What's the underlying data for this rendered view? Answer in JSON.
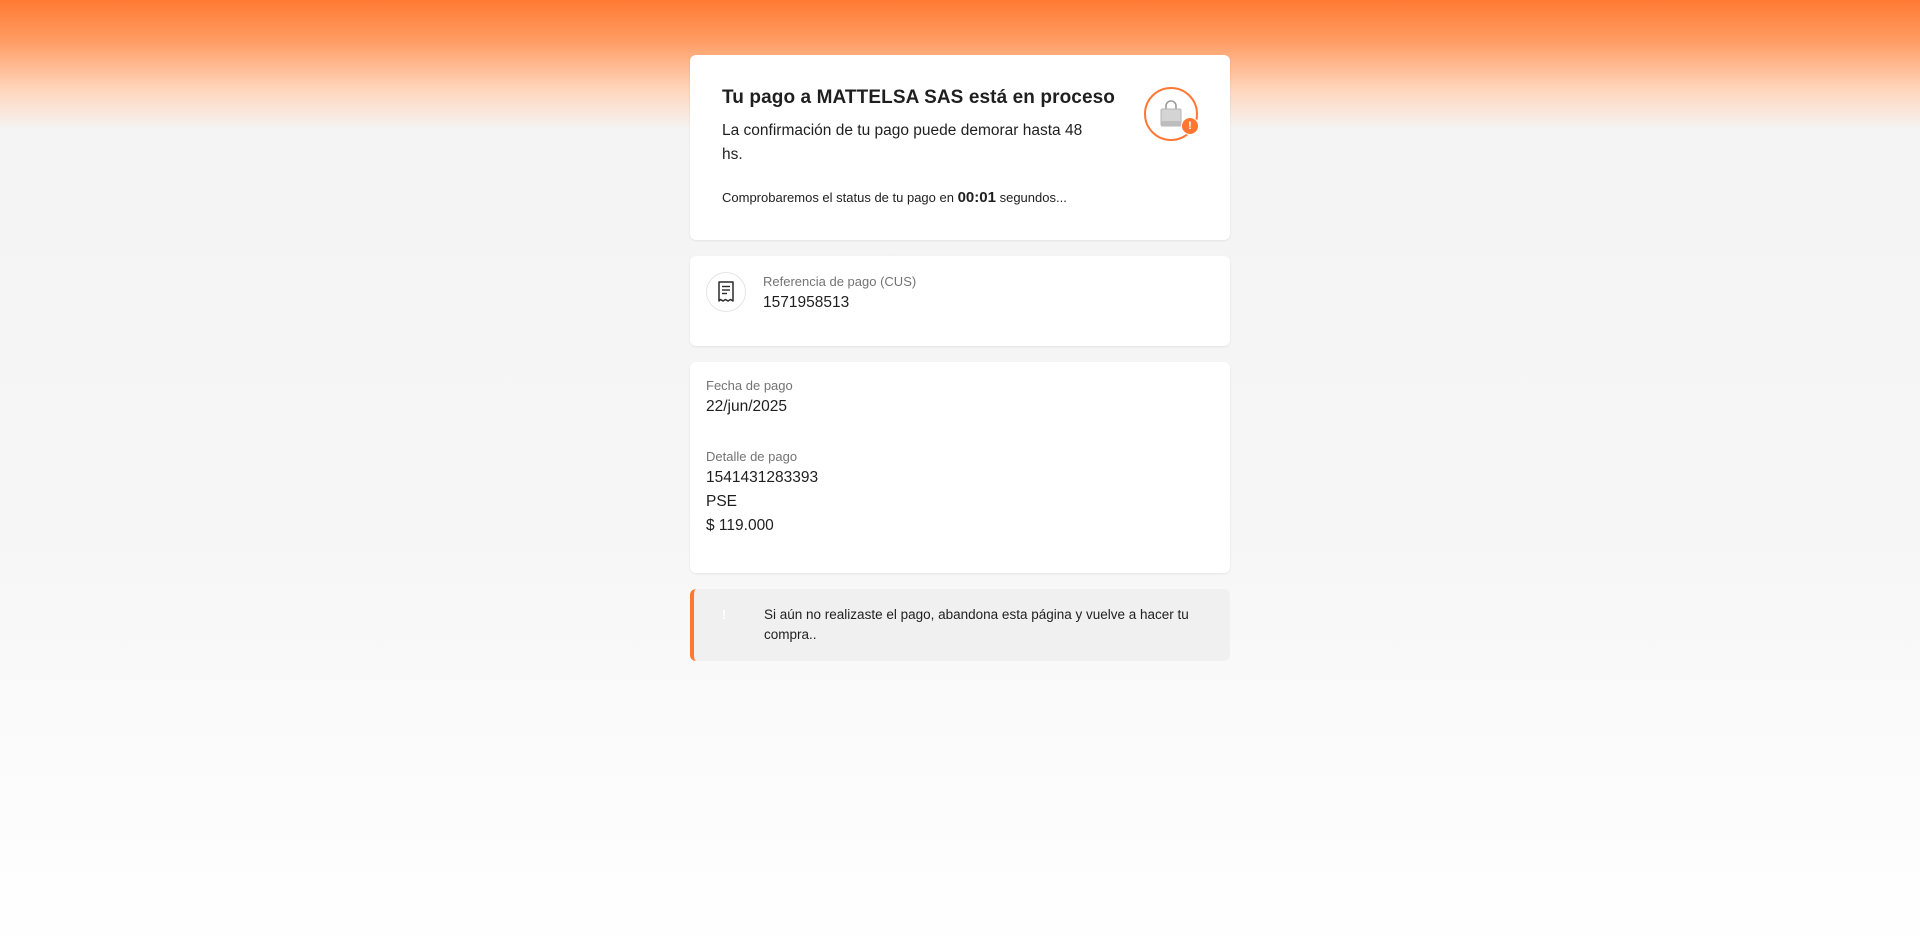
{
  "status": {
    "title": "Tu pago a MATTELSA SAS está en proceso",
    "description": "La confirmación de tu pago puede demorar hasta 48 hs.",
    "check_prefix": "Comprobaremos el status de tu pago en",
    "timer": "00:01",
    "check_suffix": "segundos...",
    "icon": "shopping-bag-icon",
    "badge": "!"
  },
  "reference": {
    "icon": "receipt-icon",
    "label": "Referencia de pago (CUS)",
    "value": "1571958513"
  },
  "details": {
    "date_label": "Fecha de pago",
    "date_value": "22/jun/2025",
    "detail_label": "Detalle de pago",
    "detail_id": "1541431283393",
    "detail_method": "PSE",
    "detail_amount": "$ 119.000"
  },
  "warning": {
    "icon": "!",
    "text": "Si aún no realizaste el pago, abandona esta página y vuelve a hacer tu compra.."
  },
  "colors": {
    "accent": "#ff7733",
    "background_top": "#ff7a33",
    "card": "#ffffff",
    "warning_bg": "#f0f0f0"
  }
}
